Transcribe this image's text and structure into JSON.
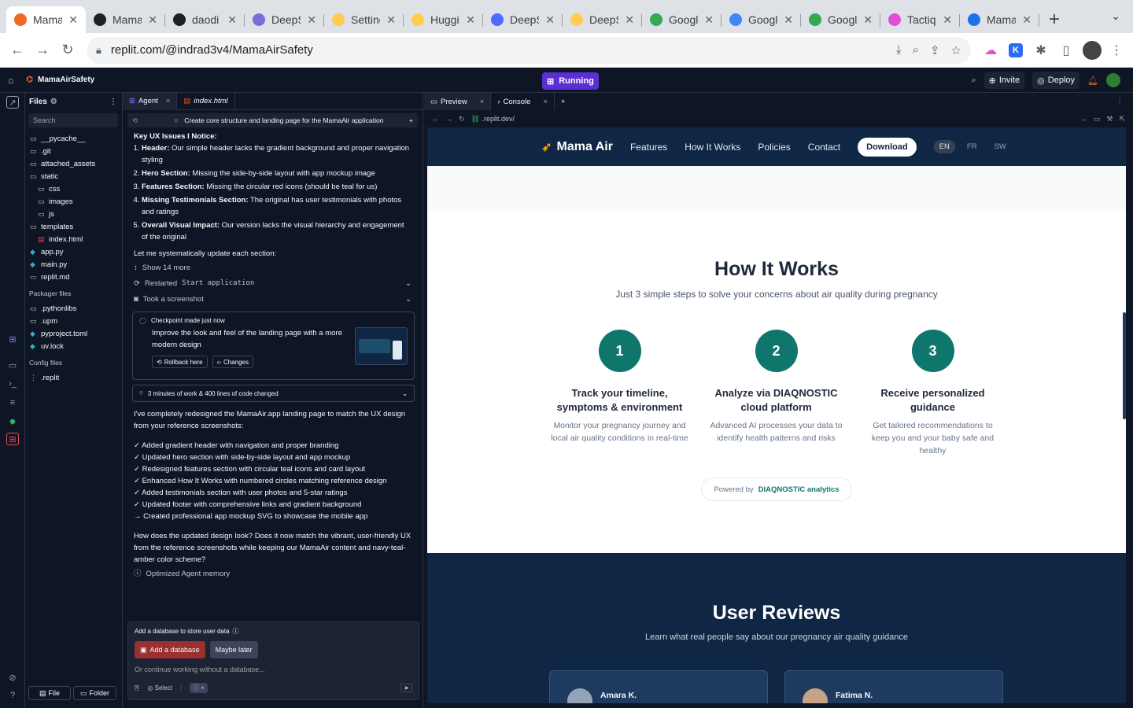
{
  "browser": {
    "tabs": [
      {
        "label": "Mama",
        "color": "#f26522",
        "active": true
      },
      {
        "label": "Mama",
        "color": "#202124"
      },
      {
        "label": "daodi",
        "color": "#202124"
      },
      {
        "label": "DeepS",
        "color": "#7b6cd9"
      },
      {
        "label": "Setting",
        "color": "#ffcc4d"
      },
      {
        "label": "Huggi",
        "color": "#ffcc4d"
      },
      {
        "label": "DeepS",
        "color": "#4d6bfe"
      },
      {
        "label": "DeepS",
        "color": "#ffcc4d"
      },
      {
        "label": "Google",
        "color": "#34a853"
      },
      {
        "label": "Googl",
        "color": "#4285f4"
      },
      {
        "label": "Googl",
        "color": "#34a853"
      },
      {
        "label": "Tactiq",
        "color": "#e04fd6"
      },
      {
        "label": "Mama",
        "color": "#1a73e8"
      }
    ],
    "url": "replit.com/@indrad3v4/MamaAirSafety"
  },
  "replit": {
    "project": "MamaAirSafety",
    "run_status": "Running",
    "invite": "Invite",
    "deploy": "Deploy"
  },
  "files": {
    "title": "Files",
    "search_placeholder": "Search",
    "tree": [
      {
        "name": "__pycache__",
        "type": "folder",
        "depth": 0
      },
      {
        "name": ".git",
        "type": "folder",
        "depth": 0
      },
      {
        "name": "attached_assets",
        "type": "folder",
        "depth": 0
      },
      {
        "name": "static",
        "type": "folder",
        "depth": 0
      },
      {
        "name": "css",
        "type": "folder",
        "depth": 1
      },
      {
        "name": "images",
        "type": "folder",
        "depth": 1
      },
      {
        "name": "js",
        "type": "folder",
        "depth": 1
      },
      {
        "name": "templates",
        "type": "folder",
        "depth": 0
      },
      {
        "name": "index.html",
        "type": "html",
        "depth": 1
      },
      {
        "name": "app.py",
        "type": "py",
        "depth": 0
      },
      {
        "name": "main.py",
        "type": "py",
        "depth": 0
      },
      {
        "name": "replit.md",
        "type": "md",
        "depth": 0
      }
    ],
    "packager_title": "Packager files",
    "packager": [
      {
        "name": ".pythonlibs",
        "type": "folder"
      },
      {
        "name": ".upm",
        "type": "folder"
      },
      {
        "name": "pyproject.toml",
        "type": "py"
      },
      {
        "name": "uv.lock",
        "type": "py"
      }
    ],
    "config_title": "Config files",
    "config": [
      {
        "name": ".replit",
        "type": "cfg"
      }
    ],
    "file_btn": "File",
    "folder_btn": "Folder"
  },
  "agent": {
    "tab_agent": "Agent",
    "tab_file": "index.html",
    "task": "Create core structure and landing page for the MamaAir application",
    "issues_title": "Key UX Issues I Notice:",
    "issues": [
      {
        "bold": "Header:",
        "text": " Our simple header lacks the gradient background and proper navigation styling"
      },
      {
        "bold": "Hero Section:",
        "text": " Missing the side-by-side layout with app mockup image"
      },
      {
        "bold": "Features Section:",
        "text": " Missing the circular red icons (should be teal for us)"
      },
      {
        "bold": "Missing Testimonials Section:",
        "text": " The original has user testimonials with photos and ratings"
      },
      {
        "bold": "Overall Visual Impact:",
        "text": " Our version lacks the visual hierarchy and engagement of the original"
      }
    ],
    "systematic": "Let me systematically update each section:",
    "show_more": "Show 14 more",
    "restarted_prefix": "Restarted",
    "restarted_code": "Start application",
    "screenshot": "Took a screenshot",
    "checkpoint_label": "Checkpoint made just now",
    "checkpoint_text": "Improve the look and feel of the landing page with a more modern design",
    "rollback": "Rollback here",
    "changes": "Changes",
    "work_summary": "3 minutes of work & 400 lines of code changed",
    "redesign_intro": "I've completely redesigned the MamaAir.app landing page to match the UX design from your reference screenshots:",
    "changes_list": [
      "✓ Added gradient header with navigation and proper branding",
      "✓ Updated hero section with side-by-side layout and app mockup",
      "✓ Redesigned features section with circular teal icons and card layout",
      "✓ Enhanced How It Works with numbered circles matching reference design",
      "✓ Added testimonials section with user photos and 5-star ratings",
      "✓ Updated footer with comprehensive links and gradient background",
      "→ Created professional app mockup SVG to showcase the mobile app"
    ],
    "question": "How does the updated design look? Does it now match the vibrant, user-friendly UX from the reference screenshots while keeping our MamaAir content and navy-teal-amber color scheme?",
    "memory": "Optimized Agent memory",
    "db_prompt": "Add a database to store user data",
    "db_add": "Add a database",
    "db_later": "Maybe later",
    "input_placeholder": "Or continue working without a database...",
    "select": "Select"
  },
  "preview": {
    "tab_preview": "Preview",
    "tab_console": "Console",
    "url": ".replit.dev/",
    "site": {
      "logo": "Mama Air",
      "nav": [
        "Features",
        "How It Works",
        "Policies",
        "Contact"
      ],
      "download": "Download",
      "langs": [
        "EN",
        "FR",
        "SW"
      ],
      "hiw_title": "How It Works",
      "hiw_sub": "Just 3 simple steps to solve your concerns about air quality during pregnancy",
      "steps": [
        {
          "num": "1",
          "title": "Track your timeline, symptoms & environment",
          "desc": "Monitor your pregnancy journey and local air quality conditions in real-time"
        },
        {
          "num": "2",
          "title": "Analyze via DIAQNOSTIC cloud platform",
          "desc": "Advanced AI processes your data to identify health patterns and risks"
        },
        {
          "num": "3",
          "title": "Receive personalized guidance",
          "desc": "Get tailored recommendations to keep you and your baby safe and healthy"
        }
      ],
      "powered_by": "Powered by",
      "powered_brand": "DIAQNOSTIC analytics",
      "reviews_title": "User Reviews",
      "reviews_sub": "Learn what real people say about our pregnancy air quality guidance",
      "reviewers": [
        "Amara K.",
        "Fatima N."
      ],
      "teal": "#0f766e",
      "navy": "#0f2744"
    }
  }
}
